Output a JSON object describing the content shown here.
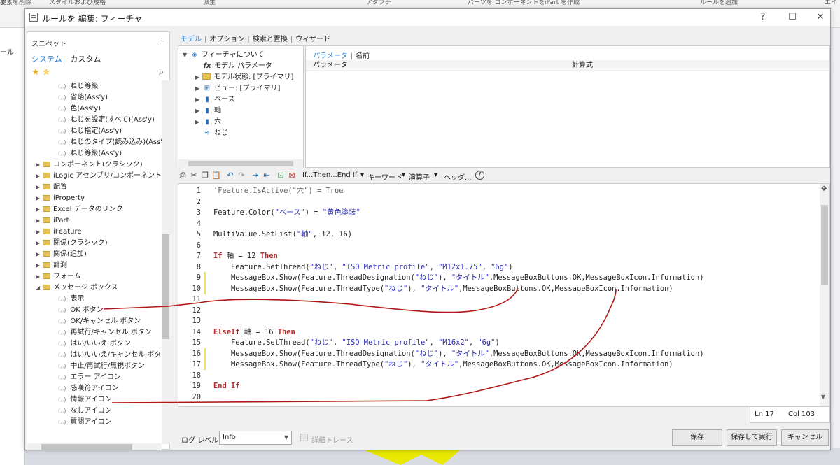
{
  "background": {
    "ribbon_tabs": [
      "要素を削除",
      "スタイルおよび規格",
      "派生",
      "アダプチ",
      "パーツを コンポーネントを",
      "iPart を作成",
      "ルールを追加",
      "エイ"
    ],
    "left_label": "ール"
  },
  "dialog": {
    "title": "ルールを 編集: フィーチャ",
    "buttons": {
      "help": "?",
      "maximize": "☐",
      "close": "✕"
    }
  },
  "snippets": {
    "title": "スニペット",
    "pin": "📌",
    "tabs": [
      "システム",
      "カスタム"
    ],
    "search_icon": "🔍",
    "items": [
      {
        "label": "ねじ等級",
        "kind": "item"
      },
      {
        "label": "省略(Ass'y)",
        "kind": "item"
      },
      {
        "label": "色(Ass'y)",
        "kind": "item"
      },
      {
        "label": "ねじを設定(すべて)(Ass'y)",
        "kind": "item"
      },
      {
        "label": "ねじ指定(Ass'y)",
        "kind": "item"
      },
      {
        "label": "ねじのタイプ(読み込み)(Ass'y)",
        "kind": "item"
      },
      {
        "label": "ねじ等級(Ass'y)",
        "kind": "item"
      },
      {
        "label": "コンポーネント(クラシック)",
        "kind": "folder"
      },
      {
        "label": "iLogic アセンブリ/コンポーネント",
        "kind": "folder"
      },
      {
        "label": "配置",
        "kind": "folder"
      },
      {
        "label": "iProperty",
        "kind": "folder"
      },
      {
        "label": "Excel データのリンク",
        "kind": "folder"
      },
      {
        "label": "iPart",
        "kind": "folder"
      },
      {
        "label": "iFeature",
        "kind": "folder"
      },
      {
        "label": "関係(クラシック)",
        "kind": "folder"
      },
      {
        "label": "関係(追加)",
        "kind": "folder"
      },
      {
        "label": "計測",
        "kind": "folder"
      },
      {
        "label": "フォーム",
        "kind": "folder"
      },
      {
        "label": "メッセージ ボックス",
        "kind": "folder-open"
      },
      {
        "label": "表示",
        "kind": "item"
      },
      {
        "label": "OK ボタン",
        "kind": "item"
      },
      {
        "label": "OK/キャンセル ボタン",
        "kind": "item"
      },
      {
        "label": "再試行/キャンセル ボタン",
        "kind": "item"
      },
      {
        "label": "はい/いいえ ボタン",
        "kind": "item"
      },
      {
        "label": "はい/いいえ/キャンセル ボタン",
        "kind": "item"
      },
      {
        "label": "中止/再試行/無視ボタン",
        "kind": "item"
      },
      {
        "label": "エラー アイコン",
        "kind": "item"
      },
      {
        "label": "感嘆符アイコン",
        "kind": "item"
      },
      {
        "label": "情報アイコン",
        "kind": "item"
      },
      {
        "label": "なしアイコン",
        "kind": "item"
      },
      {
        "label": "質問アイコン",
        "kind": "item"
      }
    ]
  },
  "main_tabs": [
    "モデル",
    "オプション",
    "検索と置換",
    "ウィザード"
  ],
  "tree": {
    "items": [
      {
        "label": "フィーチャについて",
        "icon": "part-icon",
        "glyph": "◈",
        "arrow": "▼",
        "indent": 0
      },
      {
        "label": "モデル パラメータ",
        "icon": "fx-icon",
        "glyph": "fx",
        "arrow": "",
        "indent": 1
      },
      {
        "label": "モデル状態: [プライマリ]",
        "icon": "folder-icon",
        "glyph": "",
        "arrow": "▶",
        "indent": 1
      },
      {
        "label": "ビュー: [プライマリ]",
        "icon": "view-icon",
        "glyph": "⊞",
        "arrow": "▶",
        "indent": 1
      },
      {
        "label": "ベース",
        "icon": "feature-icon",
        "glyph": "▮",
        "arrow": "▶",
        "indent": 1
      },
      {
        "label": "軸",
        "icon": "feature-icon",
        "glyph": "▮",
        "arrow": "▶",
        "indent": 1
      },
      {
        "label": "穴",
        "icon": "feature-icon",
        "glyph": "▮",
        "arrow": "▶",
        "indent": 1
      },
      {
        "label": "ねじ",
        "icon": "thread-icon",
        "glyph": "≋",
        "arrow": "",
        "indent": 1
      }
    ]
  },
  "params": {
    "tabs": [
      "パラメータ",
      "名前"
    ],
    "columns": [
      "パラメータ",
      "計算式"
    ]
  },
  "toolbar": {
    "if_then": "If...Then...End If",
    "keyword": "キーワード",
    "operator": "演算子",
    "header": "ヘッダ...",
    "help": "?"
  },
  "code": {
    "lines": [
      {
        "n": "1",
        "text": "'Feature.IsActive(\"穴\") = True",
        "changed": false
      },
      {
        "n": "2",
        "text": "",
        "changed": false
      },
      {
        "n": "3",
        "text": "Feature.Color(\"ベース\") = \"黄色塗装\"",
        "changed": false
      },
      {
        "n": "4",
        "text": "",
        "changed": false
      },
      {
        "n": "5",
        "text": "MultiValue.SetList(\"軸\", 12, 16)",
        "changed": false
      },
      {
        "n": "6",
        "text": "",
        "changed": false
      },
      {
        "n": "7",
        "text": "If 軸 = 12 Then",
        "changed": false
      },
      {
        "n": "8",
        "text": "    Feature.SetThread(\"ねじ\", \"ISO Metric profile\", \"M12x1.75\", \"6g\")",
        "changed": false
      },
      {
        "n": "9",
        "text": "    MessageBox.Show(Feature.ThreadDesignation(\"ねじ\"), \"タイトル\",MessageBoxButtons.OK,MessageBoxIcon.Information)",
        "changed": true
      },
      {
        "n": "10",
        "text": "    MessageBox.Show(Feature.ThreadType(\"ねじ\"), \"タイトル\",MessageBoxButtons.OK,MessageBoxIcon.Information)",
        "changed": true
      },
      {
        "n": "11",
        "text": "",
        "changed": false
      },
      {
        "n": "12",
        "text": "",
        "changed": false
      },
      {
        "n": "13",
        "text": "",
        "changed": false
      },
      {
        "n": "14",
        "text": "ElseIf 軸 = 16 Then",
        "changed": false
      },
      {
        "n": "15",
        "text": "    Feature.SetThread(\"ねじ\", \"ISO Metric profile\", \"M16x2\", \"6g\")",
        "changed": false
      },
      {
        "n": "16",
        "text": "    MessageBox.Show(Feature.ThreadDesignation(\"ねじ\"), \"タイトル\",MessageBoxButtons.OK,MessageBoxIcon.Information)",
        "changed": true
      },
      {
        "n": "17",
        "text": "    MessageBox.Show(Feature.ThreadType(\"ねじ\"), \"タイトル\",MessageBoxButtons.OK,MessageBoxIcon.Information)",
        "changed": true
      },
      {
        "n": "18",
        "text": "",
        "changed": false
      },
      {
        "n": "19",
        "text": "End If",
        "changed": false
      },
      {
        "n": "20",
        "text": "",
        "changed": false
      }
    ]
  },
  "status": {
    "ln": "Ln 17",
    "col": "Col 103"
  },
  "bottom": {
    "log_label": "ログ レベル",
    "log_value": "Info",
    "trace_label": "詳細トレース",
    "save": "保存",
    "save_run": "保存して実行",
    "cancel": "キャンセル"
  },
  "colors": {
    "accent": "#2a7fd4",
    "keyword": "#b02a2a",
    "string": "#2a2ab8",
    "annotation": "#b01818",
    "changed_marker": "#f0e060"
  }
}
